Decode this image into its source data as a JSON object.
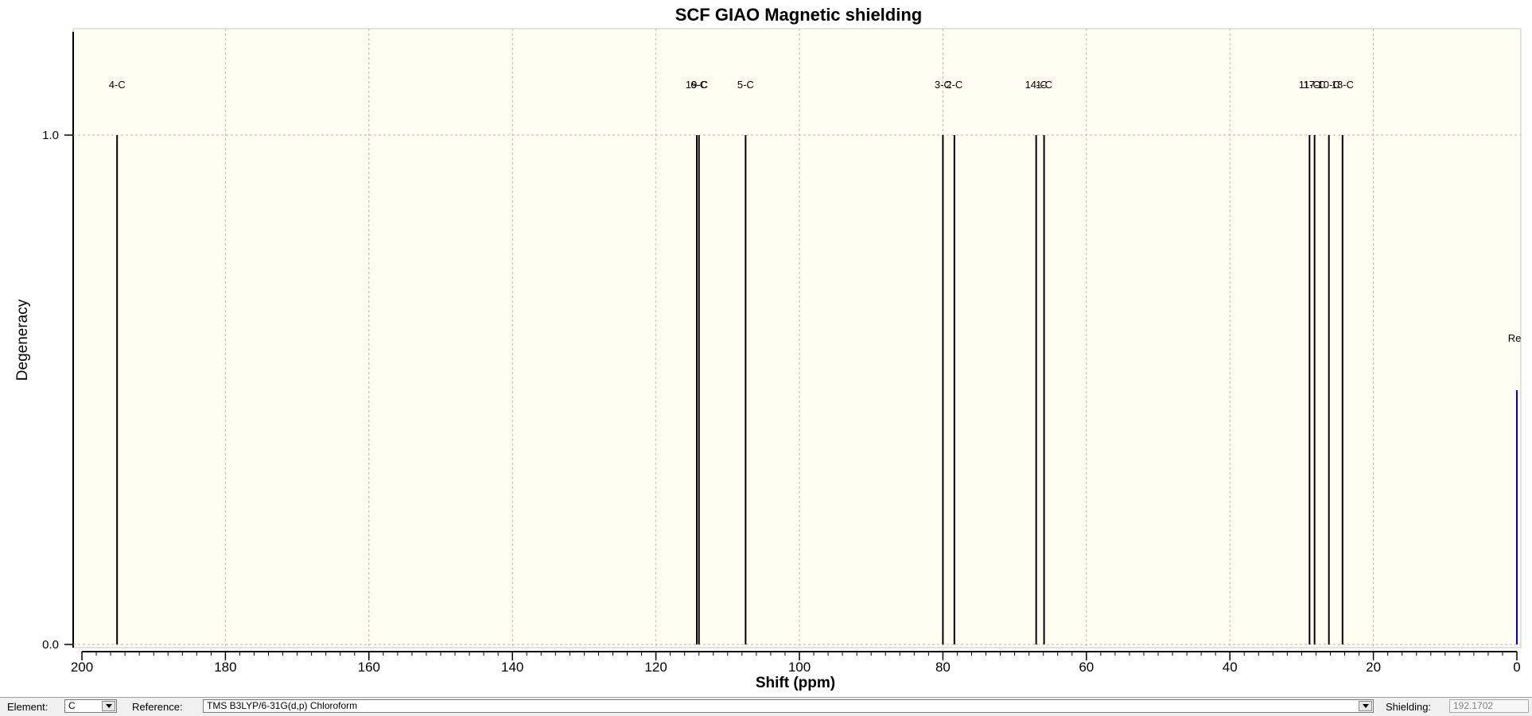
{
  "chart_data": {
    "type": "bar",
    "title": "SCF GIAO Magnetic shielding",
    "xlabel": "Shift (ppm)",
    "ylabel": "Degeneracy",
    "xlim": [
      200,
      0
    ],
    "ylim": [
      0,
      1.2
    ],
    "x_ticks": [
      200,
      180,
      160,
      140,
      120,
      100,
      80,
      60,
      40,
      20,
      0
    ],
    "y_ticks": [
      0.0,
      1.0
    ],
    "y_tick_labels": [
      "0.0",
      "1.0"
    ],
    "grid": true,
    "peaks": [
      {
        "shift": 195.1,
        "degeneracy": 1.0,
        "label": "4-C"
      },
      {
        "shift": 114.3,
        "degeneracy": 1.0,
        "label": "19-C"
      },
      {
        "shift": 114.0,
        "degeneracy": 1.0,
        "label": "6-C"
      },
      {
        "shift": 107.5,
        "degeneracy": 1.0,
        "label": "5-C"
      },
      {
        "shift": 80.0,
        "degeneracy": 1.0,
        "label": "3-C"
      },
      {
        "shift": 78.4,
        "degeneracy": 1.0,
        "label": "2-C"
      },
      {
        "shift": 67.0,
        "degeneracy": 1.0,
        "label": "14-C"
      },
      {
        "shift": 65.9,
        "degeneracy": 1.0,
        "label": "1-C"
      },
      {
        "shift": 28.9,
        "degeneracy": 1.0,
        "label": "11-C"
      },
      {
        "shift": 28.2,
        "degeneracy": 1.0,
        "label": "17-C"
      },
      {
        "shift": 26.2,
        "degeneracy": 1.0,
        "label": "10-C"
      },
      {
        "shift": 24.3,
        "degeneracy": 1.0,
        "label": "18-C"
      }
    ],
    "reference_peak": {
      "shift": 0.0,
      "degeneracy": 0.5,
      "label": "Re",
      "color": "#0000cc"
    },
    "colors": {
      "plot_bg": "#fdfdf1",
      "peak": "#000000",
      "grid": "#b8b8b8",
      "reference": "#0000cc"
    }
  },
  "bottom_bar": {
    "element_label": "Element:",
    "element_value": "C",
    "reference_label": "Reference:",
    "reference_value": "TMS B3LYP/6-31G(d,p) Chloroform",
    "shielding_label": "Shielding:",
    "shielding_value": "192.1702"
  }
}
